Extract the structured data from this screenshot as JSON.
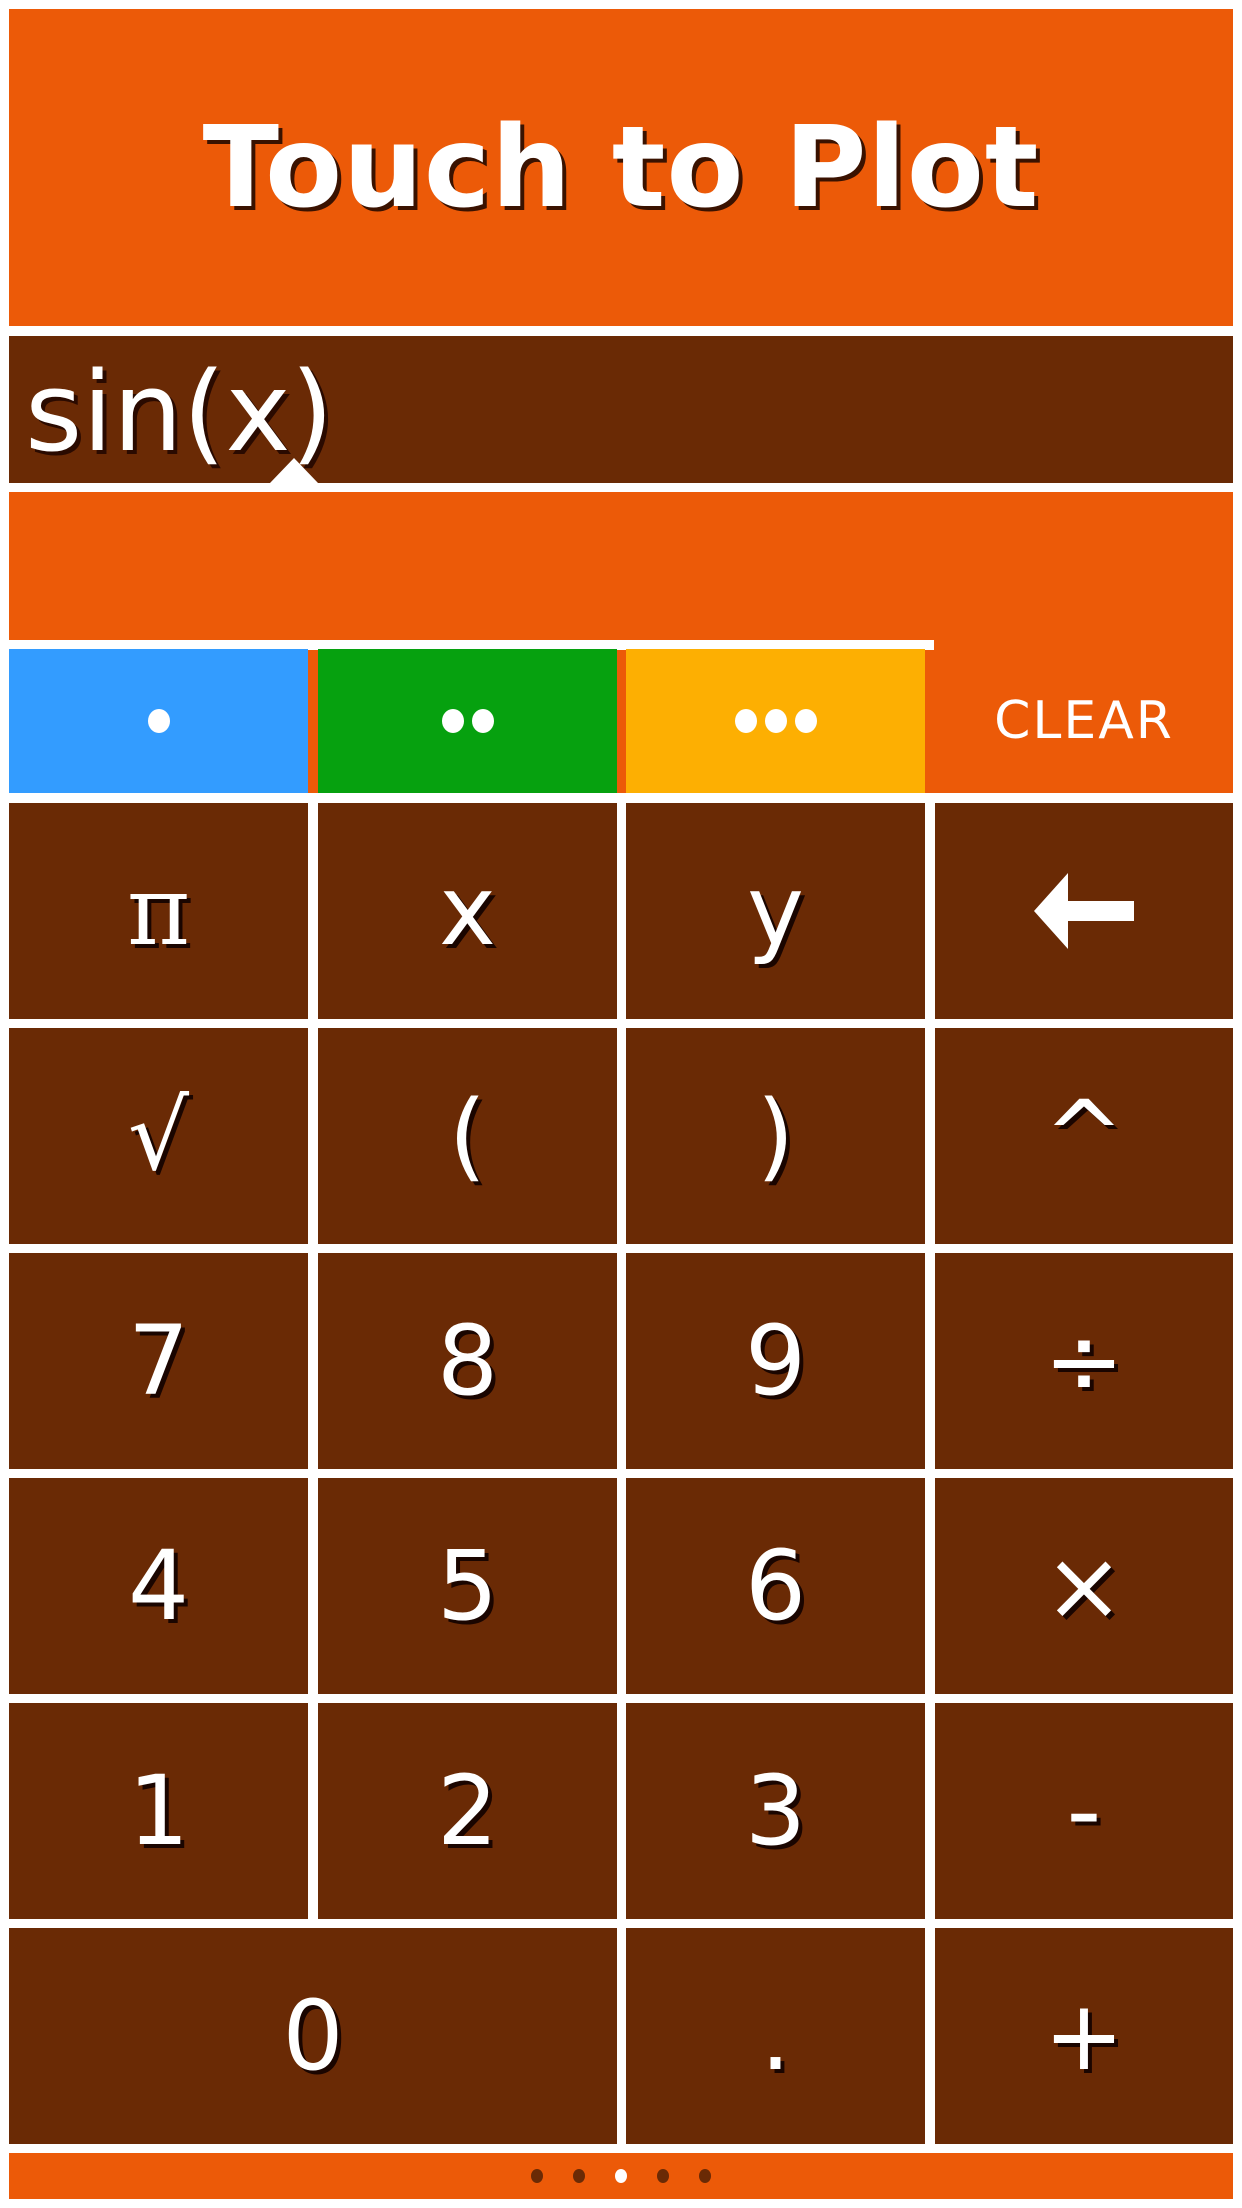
{
  "header": {
    "title": "Touch to Plot"
  },
  "expression": {
    "value": "sin(x)"
  },
  "colors": {
    "primary_orange": "#ec5a08",
    "key_brown": "#6a2a05",
    "series_blue": "#339cff",
    "series_green": "#06a10f",
    "series_yellow": "#fdaf02"
  },
  "series_buttons": [
    {
      "name": "series-1",
      "dots": 1,
      "color": "#339cff"
    },
    {
      "name": "series-2",
      "dots": 2,
      "color": "#06a10f"
    },
    {
      "name": "series-3",
      "dots": 3,
      "color": "#fdaf02"
    }
  ],
  "clear_label": "CLEAR",
  "keys": [
    [
      "π",
      "x",
      "y",
      "backspace-icon"
    ],
    [
      "√",
      "(",
      ")",
      "^"
    ],
    [
      "7",
      "8",
      "9",
      "÷"
    ],
    [
      "4",
      "5",
      "6",
      "×"
    ],
    [
      "1",
      "2",
      "3",
      "-"
    ],
    [
      "0",
      ".",
      "+"
    ]
  ],
  "page_indicator": {
    "count": 5,
    "active_index": 2
  }
}
